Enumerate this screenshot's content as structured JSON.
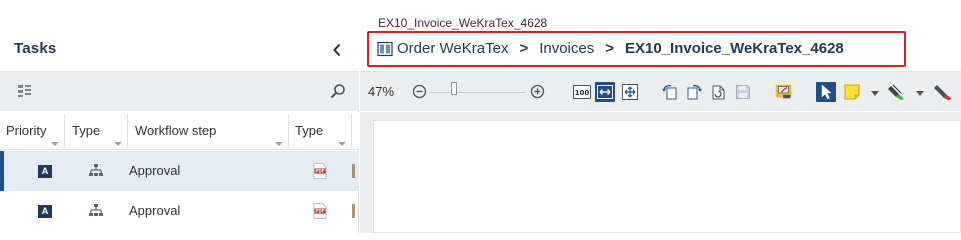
{
  "tasks_panel": {
    "title": "Tasks",
    "columns": [
      "Priority",
      "Type",
      "Workflow step",
      "Type"
    ],
    "rows": [
      {
        "priority": "A",
        "type_icon": "workflow-icon",
        "workflow_step": "Approval",
        "doc_type_icon": "pdf-icon",
        "selected": true
      },
      {
        "priority": "A",
        "type_icon": "workflow-icon",
        "workflow_step": "Approval",
        "doc_type_icon": "pdf-icon",
        "selected": false
      }
    ]
  },
  "viewer": {
    "file_name": "EX10_Invoice_WeKraTex_4628",
    "breadcrumb": [
      "Order WeKraTex",
      "Invoices",
      "EX10_Invoice_WeKraTex_4628"
    ],
    "breadcrumb_separator": ">",
    "zoom": "47%",
    "zoom_level_fraction": 0.25,
    "highlight_color": "#e31b23",
    "accent_color": "#1f4e8c"
  }
}
